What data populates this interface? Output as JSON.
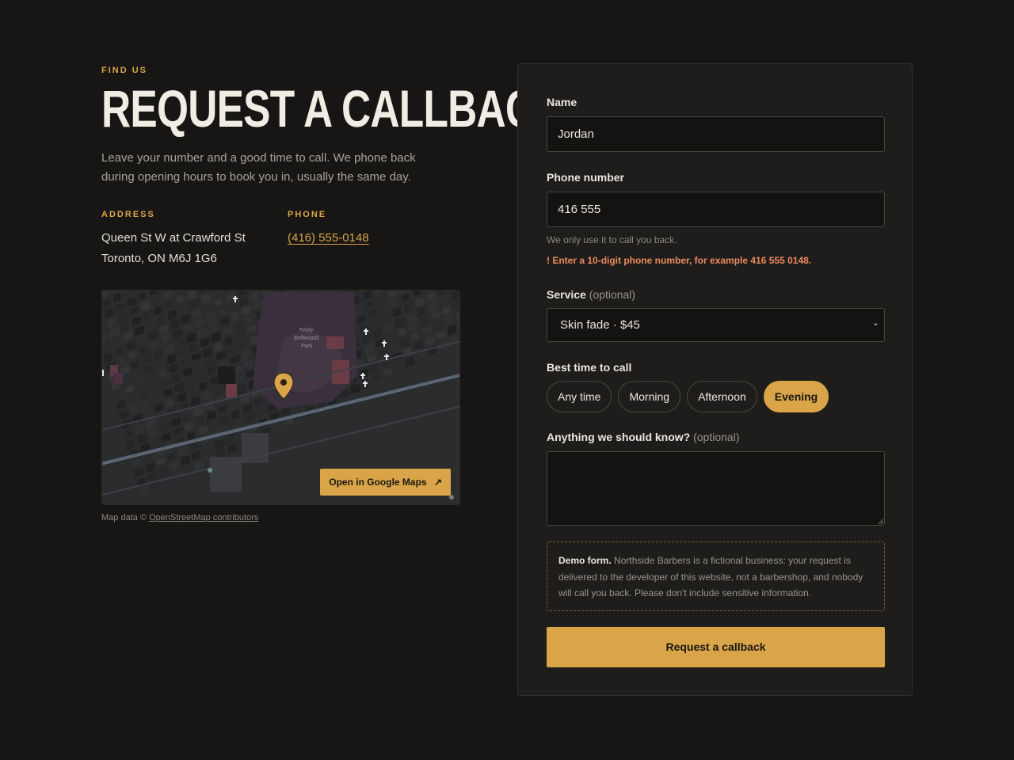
{
  "intro": {
    "eyebrow": "FIND US",
    "title": "REQUEST A CALLBACK",
    "lead": "Leave your number and a good time to call. We phone back during opening hours to book you in, usually the same day."
  },
  "contact": {
    "address_label": "ADDRESS",
    "address_line1": "Queen St W at Crawford St",
    "address_line2": "Toronto, ON M6J 1G6",
    "phone_label": "PHONE",
    "phone": "(416) 555-0148"
  },
  "map": {
    "button_label": "Open in Google Maps",
    "button_icon": "external-link-arrow-icon",
    "park_label_1": "Trinity",
    "park_label_2": "Bellwoods",
    "park_label_3": "Park",
    "credit_prefix": "Map data ©",
    "credit_link": "OpenStreetMap contributors"
  },
  "form": {
    "name_label": "Name",
    "name_value": "Jordan",
    "phone_label": "Phone number",
    "phone_value": "416 555",
    "phone_hint": "We only use it to call you back.",
    "phone_error": "! Enter a 10-digit phone number, for example 416 555 0148.",
    "service_label": "Service",
    "service_optional": "(optional)",
    "service_value": "Skin fade · $45",
    "time_label": "Best time to call",
    "time_options": [
      "Any time",
      "Morning",
      "Afternoon",
      "Evening"
    ],
    "time_selected": "Evening",
    "notes_label": "Anything we should know?",
    "notes_optional": "(optional)",
    "notes_value": "",
    "demo_bold": "Demo form.",
    "demo_text": "Northside Barbers is a fictional business: your request is delivered to the developer of this website, not a barbershop, and nobody will call you back. Please don't include sensitive information.",
    "submit_label": "Request a callback"
  },
  "colors": {
    "background": "#171615",
    "panel": "#1e1d1b",
    "accent": "#d9a548",
    "error": "#ec8a5e"
  }
}
